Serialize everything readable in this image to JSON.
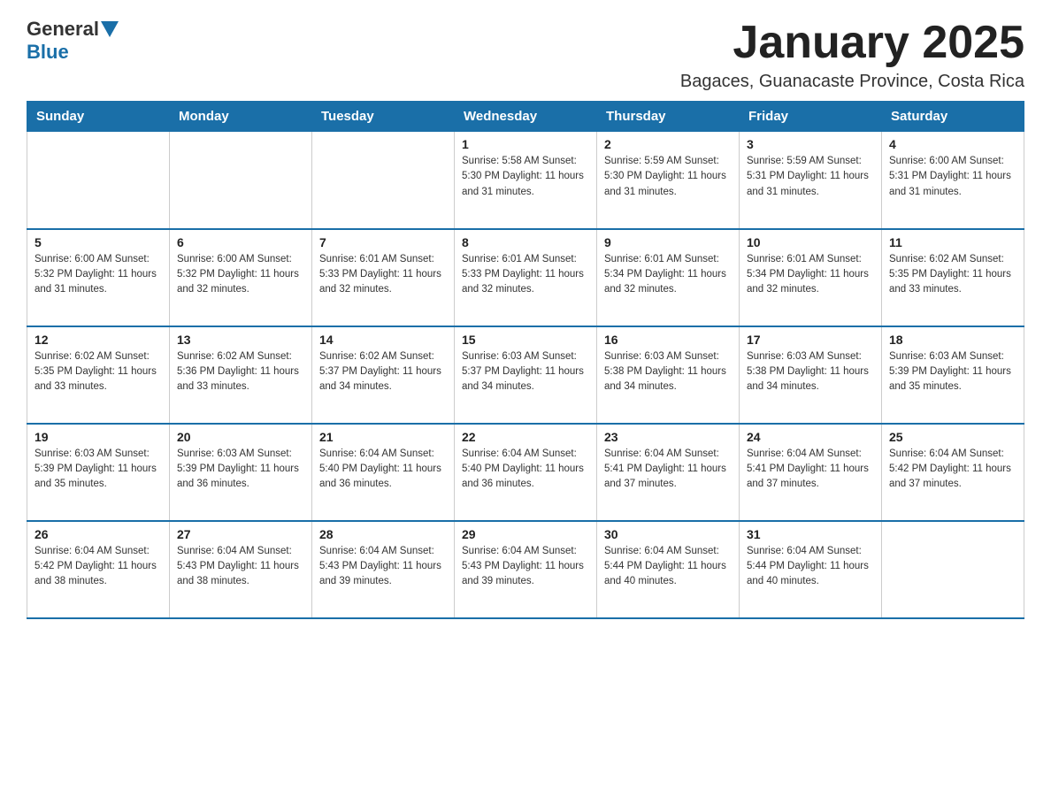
{
  "header": {
    "logo_general": "General",
    "logo_blue": "Blue",
    "month_title": "January 2025",
    "subtitle": "Bagaces, Guanacaste Province, Costa Rica"
  },
  "weekdays": [
    "Sunday",
    "Monday",
    "Tuesday",
    "Wednesday",
    "Thursday",
    "Friday",
    "Saturday"
  ],
  "weeks": [
    [
      {
        "day": "",
        "info": ""
      },
      {
        "day": "",
        "info": ""
      },
      {
        "day": "",
        "info": ""
      },
      {
        "day": "1",
        "info": "Sunrise: 5:58 AM\nSunset: 5:30 PM\nDaylight: 11 hours\nand 31 minutes."
      },
      {
        "day": "2",
        "info": "Sunrise: 5:59 AM\nSunset: 5:30 PM\nDaylight: 11 hours\nand 31 minutes."
      },
      {
        "day": "3",
        "info": "Sunrise: 5:59 AM\nSunset: 5:31 PM\nDaylight: 11 hours\nand 31 minutes."
      },
      {
        "day": "4",
        "info": "Sunrise: 6:00 AM\nSunset: 5:31 PM\nDaylight: 11 hours\nand 31 minutes."
      }
    ],
    [
      {
        "day": "5",
        "info": "Sunrise: 6:00 AM\nSunset: 5:32 PM\nDaylight: 11 hours\nand 31 minutes."
      },
      {
        "day": "6",
        "info": "Sunrise: 6:00 AM\nSunset: 5:32 PM\nDaylight: 11 hours\nand 32 minutes."
      },
      {
        "day": "7",
        "info": "Sunrise: 6:01 AM\nSunset: 5:33 PM\nDaylight: 11 hours\nand 32 minutes."
      },
      {
        "day": "8",
        "info": "Sunrise: 6:01 AM\nSunset: 5:33 PM\nDaylight: 11 hours\nand 32 minutes."
      },
      {
        "day": "9",
        "info": "Sunrise: 6:01 AM\nSunset: 5:34 PM\nDaylight: 11 hours\nand 32 minutes."
      },
      {
        "day": "10",
        "info": "Sunrise: 6:01 AM\nSunset: 5:34 PM\nDaylight: 11 hours\nand 32 minutes."
      },
      {
        "day": "11",
        "info": "Sunrise: 6:02 AM\nSunset: 5:35 PM\nDaylight: 11 hours\nand 33 minutes."
      }
    ],
    [
      {
        "day": "12",
        "info": "Sunrise: 6:02 AM\nSunset: 5:35 PM\nDaylight: 11 hours\nand 33 minutes."
      },
      {
        "day": "13",
        "info": "Sunrise: 6:02 AM\nSunset: 5:36 PM\nDaylight: 11 hours\nand 33 minutes."
      },
      {
        "day": "14",
        "info": "Sunrise: 6:02 AM\nSunset: 5:37 PM\nDaylight: 11 hours\nand 34 minutes."
      },
      {
        "day": "15",
        "info": "Sunrise: 6:03 AM\nSunset: 5:37 PM\nDaylight: 11 hours\nand 34 minutes."
      },
      {
        "day": "16",
        "info": "Sunrise: 6:03 AM\nSunset: 5:38 PM\nDaylight: 11 hours\nand 34 minutes."
      },
      {
        "day": "17",
        "info": "Sunrise: 6:03 AM\nSunset: 5:38 PM\nDaylight: 11 hours\nand 34 minutes."
      },
      {
        "day": "18",
        "info": "Sunrise: 6:03 AM\nSunset: 5:39 PM\nDaylight: 11 hours\nand 35 minutes."
      }
    ],
    [
      {
        "day": "19",
        "info": "Sunrise: 6:03 AM\nSunset: 5:39 PM\nDaylight: 11 hours\nand 35 minutes."
      },
      {
        "day": "20",
        "info": "Sunrise: 6:03 AM\nSunset: 5:39 PM\nDaylight: 11 hours\nand 36 minutes."
      },
      {
        "day": "21",
        "info": "Sunrise: 6:04 AM\nSunset: 5:40 PM\nDaylight: 11 hours\nand 36 minutes."
      },
      {
        "day": "22",
        "info": "Sunrise: 6:04 AM\nSunset: 5:40 PM\nDaylight: 11 hours\nand 36 minutes."
      },
      {
        "day": "23",
        "info": "Sunrise: 6:04 AM\nSunset: 5:41 PM\nDaylight: 11 hours\nand 37 minutes."
      },
      {
        "day": "24",
        "info": "Sunrise: 6:04 AM\nSunset: 5:41 PM\nDaylight: 11 hours\nand 37 minutes."
      },
      {
        "day": "25",
        "info": "Sunrise: 6:04 AM\nSunset: 5:42 PM\nDaylight: 11 hours\nand 37 minutes."
      }
    ],
    [
      {
        "day": "26",
        "info": "Sunrise: 6:04 AM\nSunset: 5:42 PM\nDaylight: 11 hours\nand 38 minutes."
      },
      {
        "day": "27",
        "info": "Sunrise: 6:04 AM\nSunset: 5:43 PM\nDaylight: 11 hours\nand 38 minutes."
      },
      {
        "day": "28",
        "info": "Sunrise: 6:04 AM\nSunset: 5:43 PM\nDaylight: 11 hours\nand 39 minutes."
      },
      {
        "day": "29",
        "info": "Sunrise: 6:04 AM\nSunset: 5:43 PM\nDaylight: 11 hours\nand 39 minutes."
      },
      {
        "day": "30",
        "info": "Sunrise: 6:04 AM\nSunset: 5:44 PM\nDaylight: 11 hours\nand 40 minutes."
      },
      {
        "day": "31",
        "info": "Sunrise: 6:04 AM\nSunset: 5:44 PM\nDaylight: 11 hours\nand 40 minutes."
      },
      {
        "day": "",
        "info": ""
      }
    ]
  ]
}
